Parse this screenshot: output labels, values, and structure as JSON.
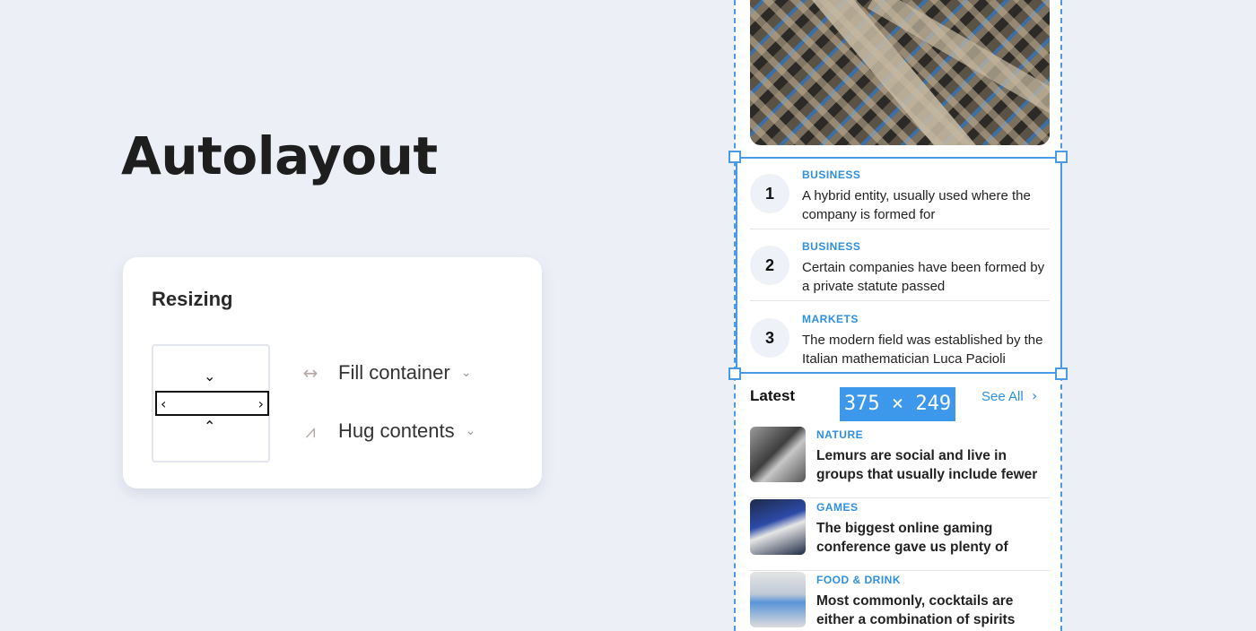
{
  "heading": "Autolayout",
  "resizing": {
    "title": "Resizing",
    "options": [
      {
        "icon": "horizontal-resize-icon",
        "label": "Fill container"
      },
      {
        "icon": "vertical-hug-icon",
        "label": "Hug contents"
      }
    ]
  },
  "selection": {
    "size_label": "375 × 249"
  },
  "ranked_list": [
    {
      "num": "1",
      "category": "BUSINESS",
      "text": "A hybrid entity, usually used where the company is formed for"
    },
    {
      "num": "2",
      "category": "BUSINESS",
      "text": "Certain companies have been formed by a private statute passed"
    },
    {
      "num": "3",
      "category": "MARKETS",
      "text": "The modern field was established by the Italian mathematician Luca Pacioli"
    }
  ],
  "latest": {
    "title": "Latest",
    "see_all": "See All",
    "articles": [
      {
        "category": "NATURE",
        "text": "Lemurs are social and live in groups that usually include fewer"
      },
      {
        "category": "GAMES",
        "text": "The biggest online gaming conference gave us plenty of"
      },
      {
        "category": "FOOD & DRINK",
        "text": "Most commonly, cocktails are either a combination of spirits"
      }
    ]
  }
}
